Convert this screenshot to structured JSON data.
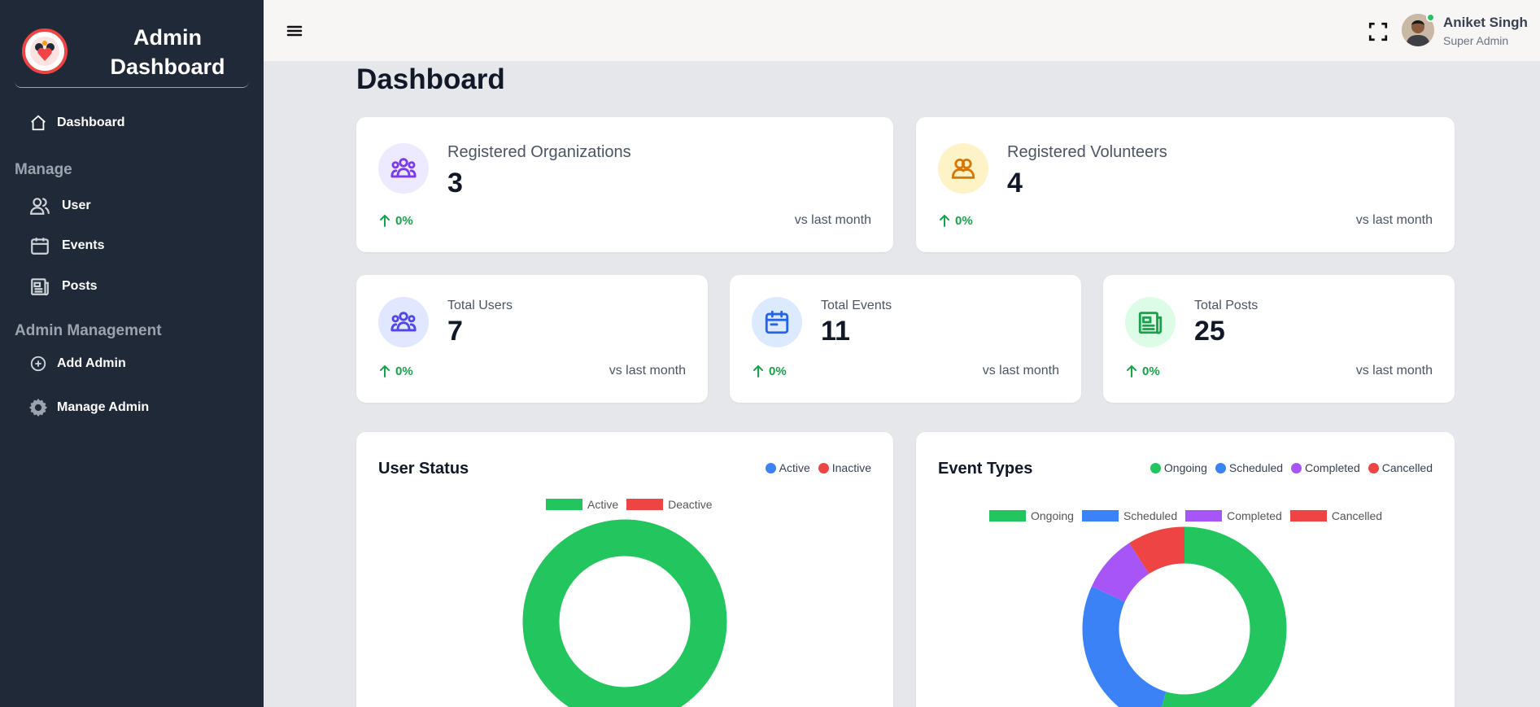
{
  "brand": {
    "title": "Admin Dashboard"
  },
  "sidebar": {
    "dashboard": "Dashboard",
    "manage_heading": "Manage",
    "user": "User",
    "events": "Events",
    "posts": "Posts",
    "admin_heading": "Admin Management",
    "add_admin": "Add Admin",
    "manage_admin": "Manage Admin"
  },
  "header": {
    "user_name": "Aniket Singh",
    "user_role": "Super Admin"
  },
  "main": {
    "title": "Dashboard",
    "stats": [
      {
        "label": "Registered Organizations",
        "value": "3",
        "trend": "0%",
        "compare": "vs last month",
        "icon": "users-group-icon",
        "color": "#7c3aed"
      },
      {
        "label": "Registered Volunteers",
        "value": "4",
        "trend": "0%",
        "compare": "vs last month",
        "icon": "user-pair-icon",
        "color": "#d97706"
      },
      {
        "label": "Total Users",
        "value": "7",
        "trend": "0%",
        "compare": "vs last month",
        "icon": "users-group-icon",
        "color": "#4f46e5"
      },
      {
        "label": "Total Events",
        "value": "11",
        "trend": "0%",
        "compare": "vs last month",
        "icon": "calendar-icon",
        "color": "#2563eb"
      },
      {
        "label": "Total Posts",
        "value": "25",
        "trend": "0%",
        "compare": "vs last month",
        "icon": "newspaper-icon",
        "color": "#16a34a"
      }
    ]
  },
  "colors": {
    "active": "#22c55e",
    "inactive": "#ef4444",
    "ongoing": "#22c55e",
    "scheduled": "#3b82f6",
    "completed": "#a855f7",
    "cancelled": "#ef4444"
  },
  "chart_data": [
    {
      "type": "pie",
      "title": "User Status",
      "header_legend": [
        "Active",
        "Inactive"
      ],
      "categories": [
        "Active",
        "Deactive"
      ],
      "values": [
        7,
        0
      ],
      "colors": [
        "#22c55e",
        "#ef4444"
      ]
    },
    {
      "type": "pie",
      "title": "Event Types",
      "header_legend": [
        "Ongoing",
        "Scheduled",
        "Completed",
        "Cancelled"
      ],
      "categories": [
        "Ongoing",
        "Scheduled",
        "Completed",
        "Cancelled"
      ],
      "values": [
        6,
        3,
        1,
        1
      ],
      "colors": [
        "#22c55e",
        "#3b82f6",
        "#a855f7",
        "#ef4444"
      ]
    }
  ]
}
